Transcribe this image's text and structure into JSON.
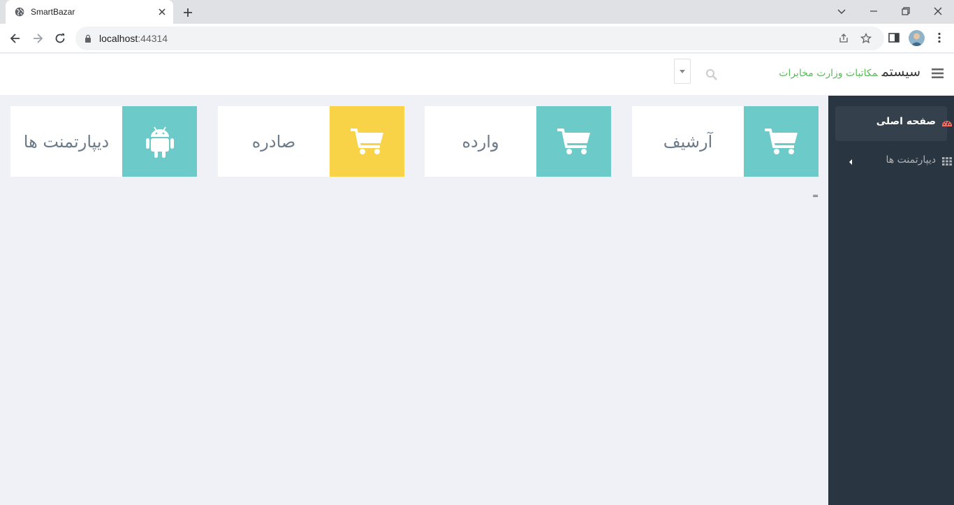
{
  "browser": {
    "tab_title": "SmartBazar",
    "url_host": "localhost",
    "url_port": ":44314"
  },
  "header": {
    "brand_main": "سیستم",
    "brand_sub": "مکاتبات وزارت مخابرات"
  },
  "sidebar": {
    "items": [
      {
        "label": "صفحه اصلی",
        "icon": "dashboard-icon",
        "active": true
      },
      {
        "label": "دیپارتمنت ها",
        "icon": "grid-icon",
        "active": false
      }
    ]
  },
  "cards": [
    {
      "label": "آرشیف",
      "icon": "cart-icon",
      "color": "#6ccac9"
    },
    {
      "label": "وارده",
      "icon": "cart-icon",
      "color": "#6ccac9"
    },
    {
      "label": "صادره",
      "icon": "cart-icon",
      "color": "#f8d347"
    },
    {
      "label": "دیپارتمنت ها",
      "icon": "android-icon",
      "color": "#6ccac9"
    }
  ],
  "misc": {
    "stray_text": "="
  },
  "colors": {
    "sidebar_bg": "#2a3542",
    "content_bg": "#f0f1f6",
    "brand_accent": "#5cb85c",
    "teal": "#6ccac9",
    "yellow": "#f8d347"
  }
}
